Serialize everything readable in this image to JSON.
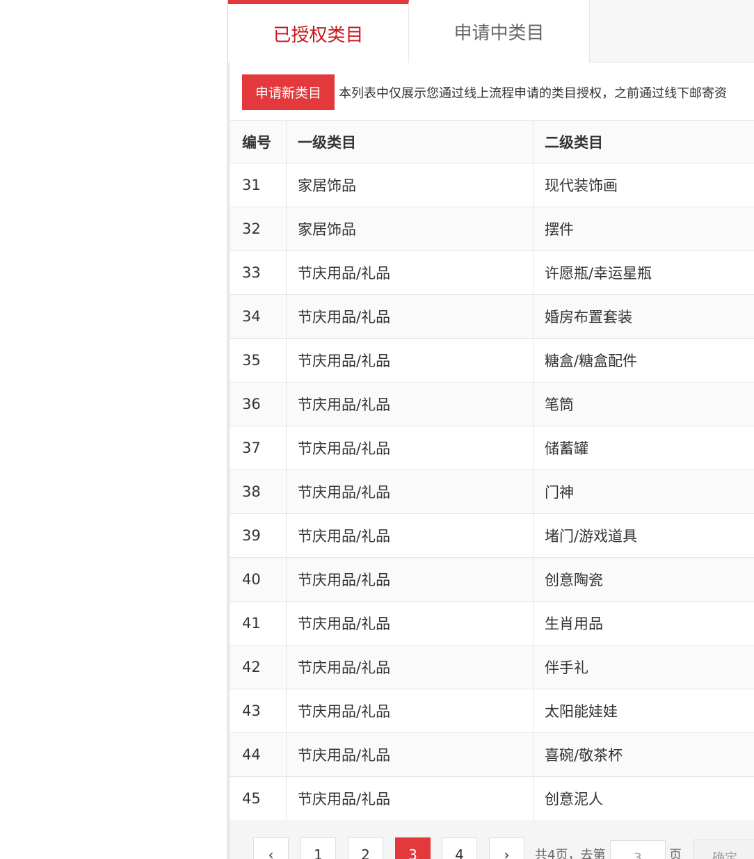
{
  "tabs": {
    "authorized": "已授权类目",
    "applying": "申请中类目"
  },
  "toolbar": {
    "apply_button": "申请新类目",
    "notice": "本列表中仅展示您通过线上流程申请的类目授权，之前通过线下邮寄资"
  },
  "table": {
    "headers": [
      "编号",
      "一级类目",
      "二级类目"
    ],
    "rows": [
      {
        "id": "31",
        "level1": "家居饰品",
        "level2": "现代装饰画"
      },
      {
        "id": "32",
        "level1": "家居饰品",
        "level2": "摆件"
      },
      {
        "id": "33",
        "level1": "节庆用品/礼品",
        "level2": "许愿瓶/幸运星瓶"
      },
      {
        "id": "34",
        "level1": "节庆用品/礼品",
        "level2": "婚房布置套装"
      },
      {
        "id": "35",
        "level1": "节庆用品/礼品",
        "level2": "糖盒/糖盒配件"
      },
      {
        "id": "36",
        "level1": "节庆用品/礼品",
        "level2": "笔筒"
      },
      {
        "id": "37",
        "level1": "节庆用品/礼品",
        "level2": "储蓄罐"
      },
      {
        "id": "38",
        "level1": "节庆用品/礼品",
        "level2": "门神"
      },
      {
        "id": "39",
        "level1": "节庆用品/礼品",
        "level2": "堵门/游戏道具"
      },
      {
        "id": "40",
        "level1": "节庆用品/礼品",
        "level2": "创意陶瓷"
      },
      {
        "id": "41",
        "level1": "节庆用品/礼品",
        "level2": "生肖用品"
      },
      {
        "id": "42",
        "level1": "节庆用品/礼品",
        "level2": "伴手礼"
      },
      {
        "id": "43",
        "level1": "节庆用品/礼品",
        "level2": "太阳能娃娃"
      },
      {
        "id": "44",
        "level1": "节庆用品/礼品",
        "level2": "喜碗/敬茶杯"
      },
      {
        "id": "45",
        "level1": "节庆用品/礼品",
        "level2": "创意泥人"
      }
    ]
  },
  "pagination": {
    "prev": "‹",
    "pages": [
      "1",
      "2",
      "3",
      "4"
    ],
    "current": "3",
    "next": "›",
    "total_text": "共4页，去第",
    "input_value": "3",
    "page_suffix": "页",
    "confirm": "确定"
  },
  "colors": {
    "accent": "#e4393c",
    "active_tab_text": "#c8161d"
  }
}
